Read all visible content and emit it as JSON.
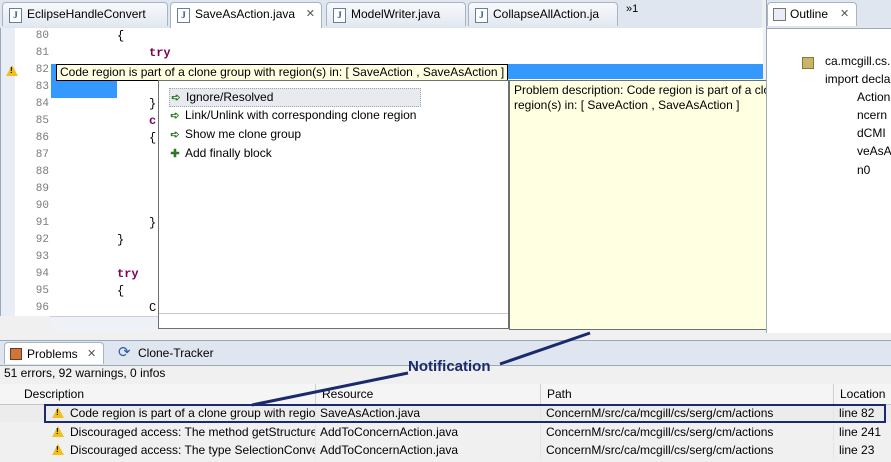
{
  "editor_tabs": [
    {
      "label": "EclipseHandleConvert",
      "active": false
    },
    {
      "label": "SaveAsAction.java",
      "active": true
    },
    {
      "label": "ModelWriter.java",
      "active": false
    },
    {
      "label": "CollapseAllAction.ja",
      "active": false
    }
  ],
  "tab_overflow": "»1",
  "tab_close": "✕",
  "editor": {
    "lines": [
      {
        "num": "80",
        "code": "{"
      },
      {
        "num": "81",
        "code": "try"
      },
      {
        "num": "82",
        "code": ""
      },
      {
        "num": "83",
        "code": ""
      },
      {
        "num": "84",
        "code": "}"
      },
      {
        "num": "85",
        "code": "c"
      },
      {
        "num": "86",
        "code": "{"
      },
      {
        "num": "87",
        "code": ""
      },
      {
        "num": "88",
        "code": ""
      },
      {
        "num": "89",
        "code": ""
      },
      {
        "num": "90",
        "code": ""
      },
      {
        "num": "91",
        "code": "}"
      },
      {
        "num": "92",
        "code": "}"
      },
      {
        "num": "93",
        "code": ""
      },
      {
        "num": "94",
        "code": "try"
      },
      {
        "num": "95",
        "code": "{"
      },
      {
        "num": "96",
        "code": "C"
      }
    ],
    "hover_tooltip": "Code region is part of a clone group with region(s) in: [ SaveAction , SaveAsAction ]"
  },
  "quick_fix": {
    "items": [
      {
        "label": "Ignore/Resolved",
        "icon": "arrow-icon",
        "selected": true
      },
      {
        "label": "Link/Unlink with corresponding clone region",
        "icon": "arrow-icon",
        "selected": false
      },
      {
        "label": "Show me clone group",
        "icon": "arrow-icon",
        "selected": false
      },
      {
        "label": "Add finally block",
        "icon": "plus-icon",
        "selected": false
      }
    ],
    "description": "Problem description: Code region is part of a clone group with region(s) in: [ SaveAction , SaveAsAction ]"
  },
  "outline": {
    "tab_label": "Outline",
    "items": [
      "ca.mcgill.cs.",
      "import declar",
      "Action",
      "ncern",
      "dCMI",
      "veAsA",
      "n0"
    ]
  },
  "problems": {
    "tab_label": "Problems",
    "clone_tab_label": "Clone-Tracker",
    "summary": "51 errors, 92 warnings, 0 infos",
    "columns": [
      "Description",
      "Resource",
      "Path",
      "Location"
    ],
    "rows": [
      {
        "description": "Code region is part of a clone group with regio",
        "resource": "SaveAsAction.java",
        "path": "ConcernM/src/ca/mcgill/cs/serg/cm/actions",
        "location": "line 82"
      },
      {
        "description": "Discouraged access: The method getStructurec",
        "resource": "AddToConcernAction.java",
        "path": "ConcernM/src/ca/mcgill/cs/serg/cm/actions",
        "location": "line 241"
      },
      {
        "description": "Discouraged access: The type SelectionConvert",
        "resource": "AddToConcernAction.java",
        "path": "ConcernM/src/ca/mcgill/cs/serg/cm/actions",
        "location": "line 23"
      }
    ]
  },
  "annotation": {
    "label": "Notification"
  },
  "colors": {
    "selection": "#3399ff",
    "tooltip_bg": "#ffffe1",
    "annotation": "#1a2a6c",
    "keyword": "#7f0055"
  }
}
